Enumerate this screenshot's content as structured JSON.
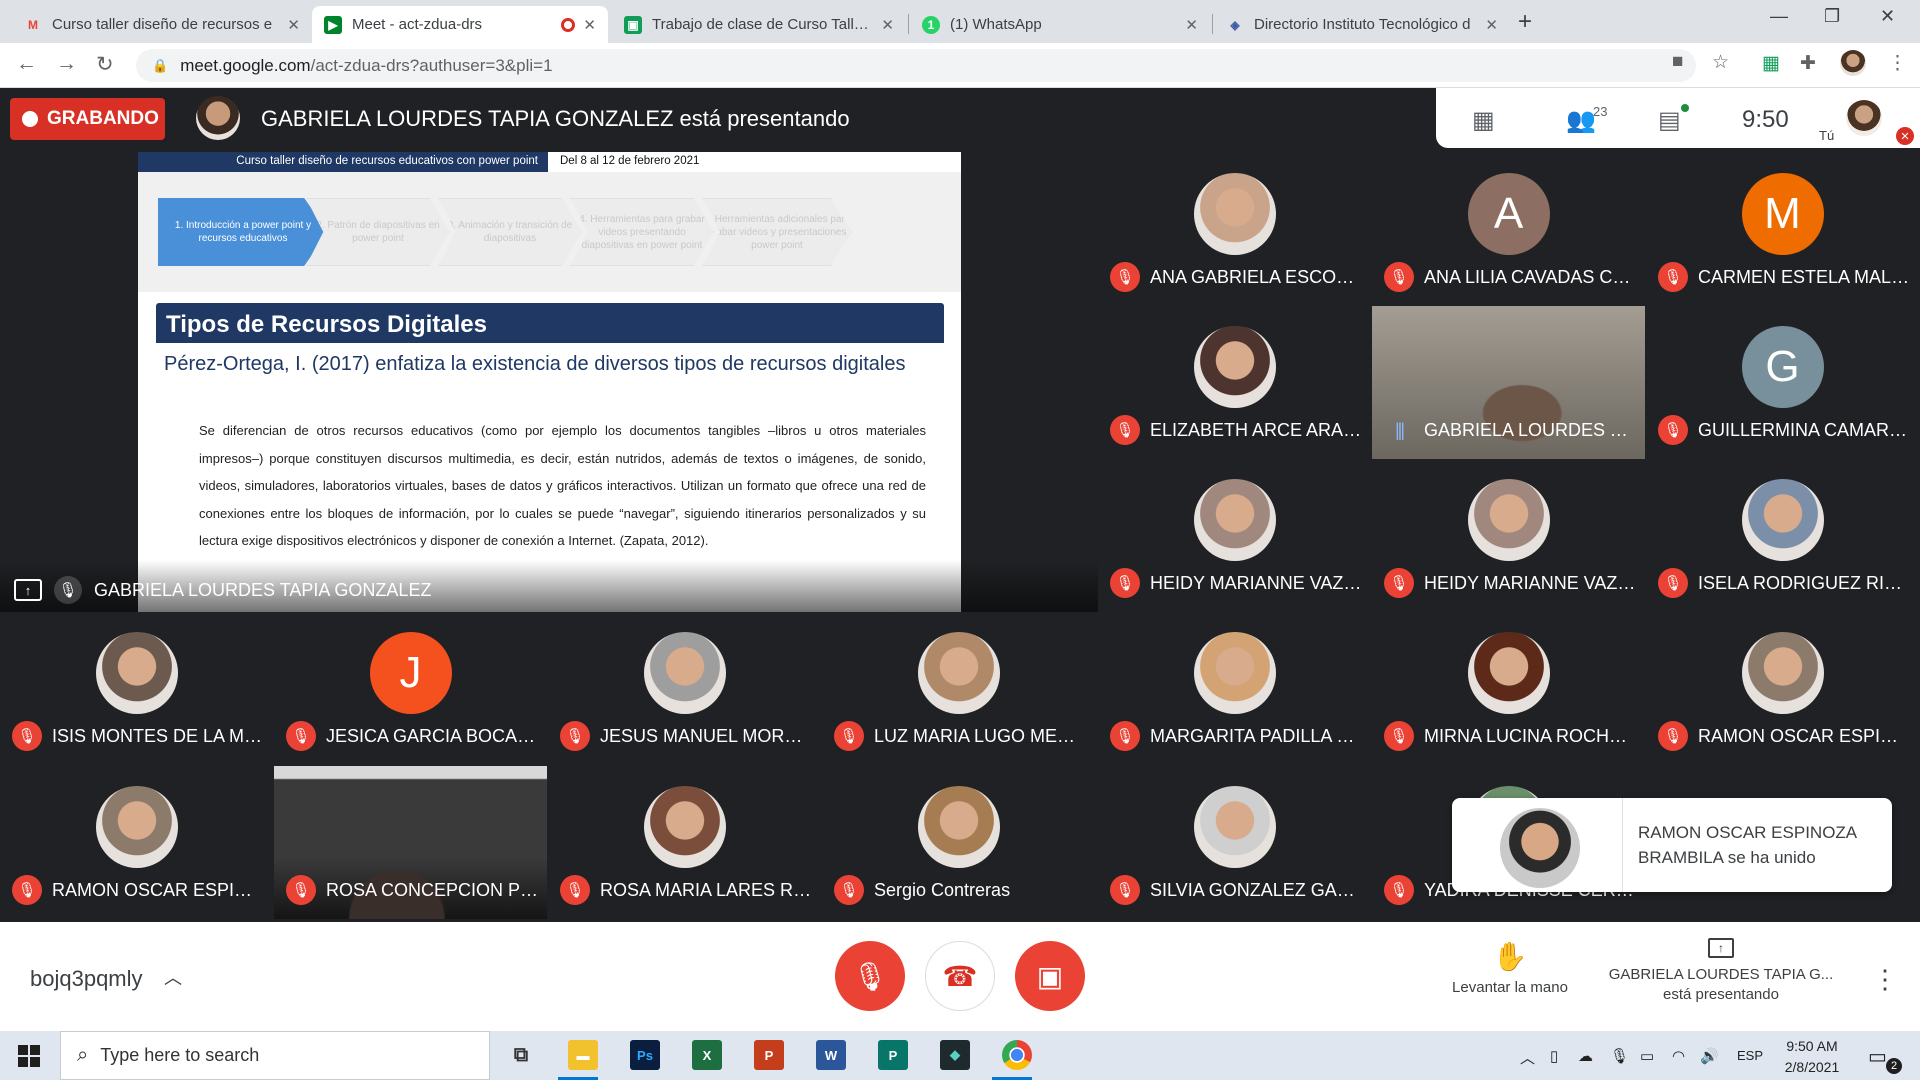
{
  "browser": {
    "tabs": [
      {
        "title": "Curso taller diseño de recursos e",
        "icon": "gmail-icon",
        "color": "#ea4335"
      },
      {
        "title": "Meet - act-zdua-drs",
        "icon": "meet-icon",
        "color": "#00832d"
      },
      {
        "title": "Trabajo de clase de Curso Taller D",
        "icon": "classroom-icon",
        "color": "#0f9d58"
      },
      {
        "title": "(1) WhatsApp",
        "icon": "whatsapp-icon",
        "color": "#25d366"
      },
      {
        "title": "Directorio Instituto Tecnológico d",
        "icon": "directory-icon",
        "color": "#3b5ba5"
      }
    ],
    "new_tab": "+",
    "url_host": "meet.google.com",
    "url_path": "/act-zdua-drs?authuser=3&pli=1"
  },
  "meet": {
    "recording_label": "GRABANDO",
    "presenter_banner": "GABRIELA LOURDES TAPIA GONZALEZ está presentando",
    "participants_count": "23",
    "clock": "9:50",
    "you_label": "Tú",
    "presentation_owner": "GABRIELA LOURDES TAPIA GONZALEZ",
    "meeting_code": "bojq3pqmly",
    "raise_hand_label": "Levantar la mano",
    "presenting_line1": "GABRIELA LOURDES TAPIA G...",
    "presenting_line2": "está presentando",
    "toast_message": "RAMON OSCAR ESPINOZA BRAMBILA se ha unido"
  },
  "slide": {
    "header_course": "Curso taller diseño de recursos educativos con power point",
    "header_dates": "Del 8 al 12 de febrero 2021",
    "steps": [
      "1. Introducción a power point y recursos educativos",
      "2. Patrón de diapositivas en power point",
      "3. Animación y transición de diapositivas",
      "4. Herramientas para grabar videos presentando diapositivas en power point",
      "5. Herramientas adicionales para grabar videos y presentaciones power point"
    ],
    "title": "Tipos de Recursos Digitales",
    "lead": "Pérez-Ortega, I. (2017) enfatiza la existencia de diversos tipos de recursos digitales",
    "body": "Se diferencian de otros recursos educativos (como por ejemplo los documentos tangibles –libros u otros materiales impresos–) porque constituyen discursos multimedia, es decir, están nutridos, además de textos o imágenes, de sonido, videos, simuladores, laboratorios virtuales, bases de datos y gráficos interactivos. Utilizan un formato que ofrece una red de conexiones entre los bloques de información, por lo cuales se puede “navegar”, siguiendo itinerarios personalizados y su lectura exige dispositivos electrónicos y disponer de conexión a Internet. (Zapata, 2012)."
  },
  "participants": [
    {
      "name": "ANA GABRIELA ESCOBE...",
      "avatar": "photo",
      "color": "#c9a48a"
    },
    {
      "name": "ANA LILIA CAVADAS CO...",
      "avatar": "A",
      "color": "#8d6e63"
    },
    {
      "name": "CARMEN ESTELA MALD...",
      "avatar": "M",
      "color": "#ef6c00"
    },
    {
      "name": "ELIZABETH ARCE ARAG...",
      "avatar": "photo",
      "color": "#4e342e"
    },
    {
      "name": "GABRIELA LOURDES TAP...",
      "avatar": "video",
      "color": "#8a8478"
    },
    {
      "name": "GUILLERMINA CAMARE...",
      "avatar": "G",
      "color": "#78909c"
    },
    {
      "name": "HEIDY MARIANNE VAZQ...",
      "avatar": "photo",
      "color": "#a1887f"
    },
    {
      "name": "HEIDY MARIANNE VAZQ...",
      "avatar": "photo",
      "color": "#a1887f"
    },
    {
      "name": "ISELA RODRIGUEZ RIVERA",
      "avatar": "photo",
      "color": "#7b8fa8"
    },
    {
      "name": "ISIS MONTES DE LA MO...",
      "avatar": "photo",
      "color": "#6d5a4e"
    },
    {
      "name": "JESICA GARCIA BOCANE...",
      "avatar": "J",
      "color": "#f4511e"
    },
    {
      "name": "JESUS MANUEL MOREN...",
      "avatar": "photo",
      "color": "#9e9e9e"
    },
    {
      "name": "LUZ MARIA LUGO MEND...",
      "avatar": "photo",
      "color": "#b08968"
    },
    {
      "name": "MARGARITA PADILLA RA...",
      "avatar": "photo",
      "color": "#d4a373"
    },
    {
      "name": "MIRNA LUCINA ROCHA P...",
      "avatar": "photo",
      "color": "#5d2a1a"
    },
    {
      "name": "RAMON OSCAR ESPINOZ...",
      "avatar": "photo",
      "color": "#8c7b6b"
    },
    {
      "name": "RAMON OSCAR ESPINOZ...",
      "avatar": "photo",
      "color": "#8c7b6b"
    },
    {
      "name": "ROSA CONCEPCION PIZ...",
      "avatar": "video",
      "color": "#3d3d3d"
    },
    {
      "name": "ROSA MARIA LARES REY...",
      "avatar": "photo",
      "color": "#7a4e3a"
    },
    {
      "name": "Sergio Contreras",
      "avatar": "photo",
      "color": "#a67c52"
    },
    {
      "name": "SILVIA GONZALEZ GARCIA",
      "avatar": "photo",
      "color": "#cfcfcf"
    },
    {
      "name": "YADIRA DENISSE CERDA ...",
      "avatar": "photo",
      "color": "#6a8f6a"
    }
  ],
  "taskbar": {
    "search_placeholder": "Type here to search",
    "apps": [
      "task-view-icon",
      "file-explorer-icon",
      "photoshop-icon",
      "excel-icon",
      "powerpoint-icon",
      "word-icon",
      "publisher-icon",
      "editor-icon",
      "chrome-icon"
    ],
    "language": "ESP",
    "time": "9:50 AM",
    "date": "2/8/2021",
    "notifications": "2"
  }
}
